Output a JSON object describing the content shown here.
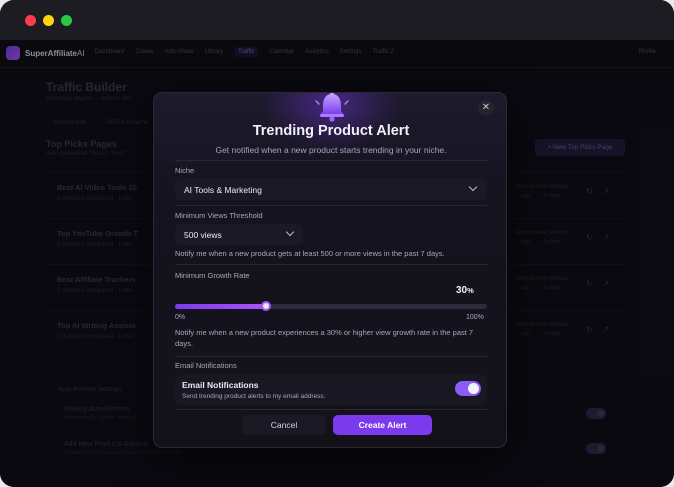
{
  "window": {
    "controls": [
      "close",
      "minimize",
      "maximize"
    ]
  },
  "topnav": {
    "brand_a": "SuperAffiliate",
    "brand_b": "AI",
    "items": [
      "Dashboard",
      "Create",
      "Auto-Mode",
      "Library",
      "Traffic",
      "Calendar",
      "Analytics",
      "Settings",
      "Traffic 2"
    ],
    "active_index": 4,
    "profile": "Profile"
  },
  "page": {
    "title": "Traffic Builder",
    "subtitle": "Discovery engine — build in-link",
    "chips": [
      "Review Hub",
      "SEO & Schema"
    ],
    "section_title": "Top Picks Pages",
    "section_subtitle": "Auto-generated \"Best X Tools\"",
    "new_button": "+  New Top Picks Page",
    "rows": [
      {
        "title": "Best AI Video Tools 20",
        "sub": "8 products compared · Links",
        "meta1": "Refresh\nago",
        "meta2": "Next Refresh\n6 days"
      },
      {
        "title": "Top YouTube Growth T",
        "sub": "6 products compared · Links",
        "meta1": "Refresh\nago",
        "meta2": "Next Refresh\n3 days"
      },
      {
        "title": "Best Affiliate Trackers",
        "sub": "6 products compared · Links",
        "meta1": "Refresh\nago",
        "meta2": "Next Refresh\n6 days"
      },
      {
        "title": "Top AI Writing Assista",
        "sub": "7 products compared · Links",
        "meta1": "Refresh\nago",
        "meta2": "Next Refresh\n7 days"
      }
    ],
    "auto_refresh_title": "Auto-Refresh Settings",
    "auto_items": [
      {
        "label": "Weekly Auto-Refresh",
        "sub": "Automatically update rankings"
      },
      {
        "label": "Add New Products Automa",
        "sub": "Include newly reviewed products in relevant lists"
      }
    ]
  },
  "modal": {
    "icon": "bell-icon",
    "close_icon": "close-icon",
    "close_glyph": "✕",
    "title": "Trending Product Alert",
    "subtitle": "Get notified when a new product starts trending in your niche.",
    "niche_label": "Niche",
    "niche_value": "AI Tools & Marketing",
    "views_label": "Minimum Views Threshold",
    "views_value": "500 views",
    "views_note": "Notify me when a new product gets at least 500 or more views in the past 7 days.",
    "growth_label": "Minimum Growth Rate",
    "growth_value": "30",
    "growth_unit": "%",
    "growth_fraction": 0.3,
    "growth_min": "0%",
    "growth_max": "100%",
    "growth_note": "Notify me when a new product experiences a 30% or higher view growth rate in the past 7 days.",
    "email_section_label": "Email Notifications",
    "email_title": "Email Notifications",
    "email_sub": "Send trending product alerts to my email address.",
    "email_enabled": true,
    "cancel_label": "Cancel",
    "create_label": "Create Alert"
  },
  "colors": {
    "accent": "#7c3aed",
    "accent_light": "#a855f7",
    "background": "#0d0c14",
    "modal_bg": "#15131e"
  }
}
